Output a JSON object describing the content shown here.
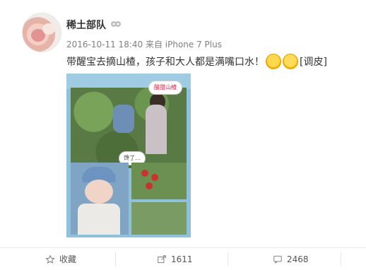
{
  "post": {
    "username": "稀土部队",
    "meta_line": "2016-10-11 18:40 来自 iPhone 7 Plus",
    "text": "带醒宝去摘山楂，孩子和大人都是满嘴口水！",
    "tag": "[调皮]"
  },
  "image_overlays": {
    "bubble_top": "酸甜山楂",
    "bubble_mid": "馋了..."
  },
  "actions": {
    "favorite_label": "收藏",
    "share_count": "1611",
    "comment_count": "2468"
  }
}
